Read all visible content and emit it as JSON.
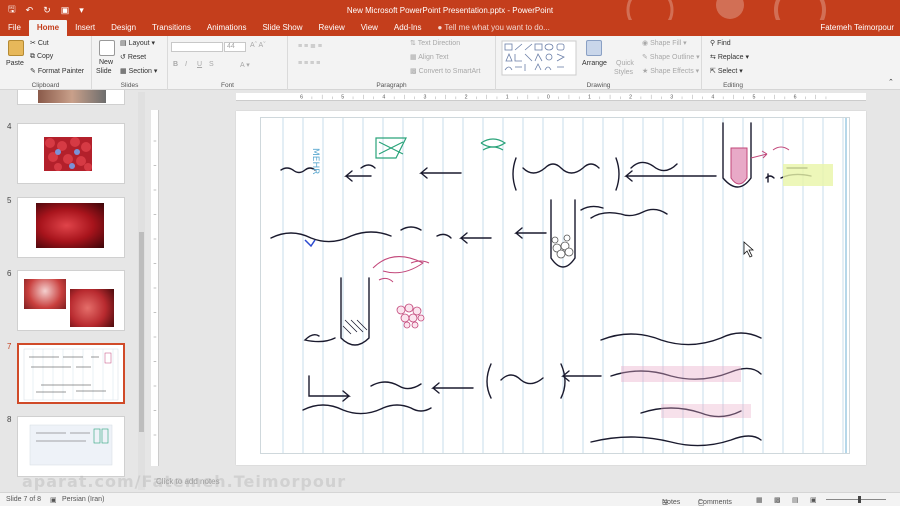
{
  "titlebar": {
    "doc_title": "New Microsoft PowerPoint Presentation.pptx - PowerPoint",
    "user": "Fatemeh Teimorpour"
  },
  "tabs": [
    "File",
    "Home",
    "Insert",
    "Design",
    "Transitions",
    "Animations",
    "Slide Show",
    "Review",
    "View",
    "Add-Ins"
  ],
  "active_tab": "Home",
  "tell_me": "Tell me what you want to do...",
  "ribbon": {
    "clipboard": {
      "paste": "Paste",
      "cut": "Cut",
      "copy": "Copy",
      "format_painter": "Format Painter",
      "label": "Clipboard"
    },
    "slides": {
      "new_slide": "New",
      "new_slide2": "Slide",
      "layout": "Layout",
      "reset": "Reset",
      "section": "Section",
      "label": "Slides"
    },
    "font": {
      "size": "44",
      "label": "Font",
      "bold": "B",
      "italic": "I",
      "underline": "U",
      "strike": "S"
    },
    "paragraph": {
      "text_direction": "Text Direction",
      "align_text": "Align Text",
      "smartart": "Convert to SmartArt",
      "label": "Paragraph"
    },
    "drawing": {
      "arrange": "Arrange",
      "quick_styles": "Quick",
      "quick_styles2": "Styles",
      "shape_fill": "Shape Fill",
      "shape_outline": "Shape Outline",
      "shape_effects": "Shape Effects",
      "label": "Drawing"
    },
    "editing": {
      "find": "Find",
      "replace": "Replace",
      "select": "Select",
      "label": "Editing"
    }
  },
  "thumbnails": [
    {
      "num": "4"
    },
    {
      "num": "5"
    },
    {
      "num": "6"
    },
    {
      "num": "7",
      "selected": true
    },
    {
      "num": "8"
    }
  ],
  "ruler_numbers": [
    "6",
    "5",
    "4",
    "3",
    "2",
    "1",
    "0",
    "1",
    "2",
    "3",
    "4",
    "5",
    "6"
  ],
  "notes_placeholder": "Click to add notes",
  "status": {
    "slide_info": "Slide 7 of 8",
    "language": "Persian (Iran)",
    "notes": "Notes",
    "comments": "Comments"
  },
  "watermark": "aparat.com/Fatemeh.Teimorpour",
  "colors": {
    "accent": "#c43e1c",
    "ink": "#1a1a2e",
    "pink": "#d6417a",
    "green": "#2aa37a",
    "highlight": "#e8f5a8"
  }
}
